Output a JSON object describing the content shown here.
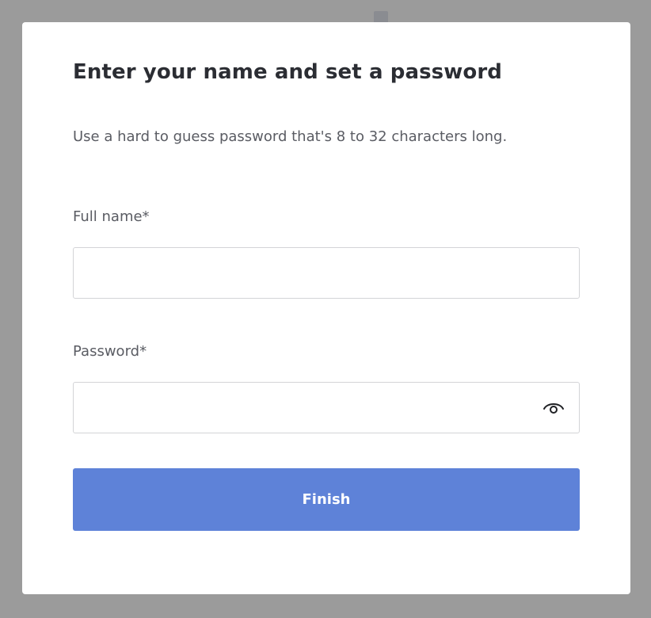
{
  "dialog": {
    "title": "Enter your name and set a password",
    "subtitle": "Use a hard to guess password that's 8 to 32 characters long."
  },
  "form": {
    "full_name": {
      "label": "Full name*",
      "value": "",
      "placeholder": ""
    },
    "password": {
      "label": "Password*",
      "value": "",
      "placeholder": "",
      "toggle_icon": "eye-icon"
    },
    "submit_label": "Finish"
  },
  "colors": {
    "backdrop": "#9b9b9b",
    "primary_button": "#5e82d8"
  }
}
